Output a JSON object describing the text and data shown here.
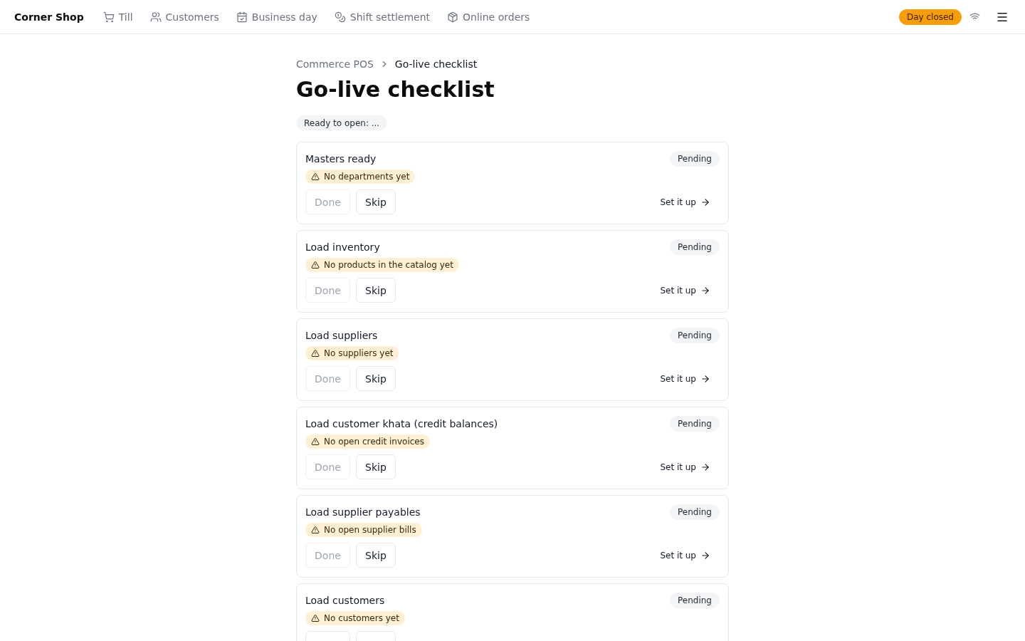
{
  "top_bar": {
    "brand": "Corner Shop",
    "nav": [
      {
        "label": "Till",
        "selected": false
      },
      {
        "label": "Customers",
        "selected": false
      },
      {
        "label": "Business day",
        "selected": false
      },
      {
        "label": "Shift settlement",
        "selected": false
      },
      {
        "label": "Online orders",
        "selected": false
      }
    ],
    "day_status": {
      "label": "Day closed",
      "open": false
    }
  },
  "breadcrumb": [
    {
      "label": "Commerce POS",
      "current": false
    },
    {
      "label": "Go-live checklist",
      "current": true
    }
  ],
  "title": "Go-live checklist",
  "readiness": "Ready to open: ...",
  "steps": [
    {
      "title": "Masters ready",
      "status": "Pending",
      "warning": "No departments yet",
      "actions": [
        {
          "kind": "done",
          "label": "Done",
          "disabled": true
        },
        {
          "kind": "skip",
          "label": "Skip",
          "disabled": false
        },
        {
          "kind": "setup",
          "label": "Set it up"
        }
      ]
    },
    {
      "title": "Load inventory",
      "status": "Pending",
      "warning": "No products in the catalog yet",
      "actions": [
        {
          "kind": "done",
          "label": "Done",
          "disabled": true
        },
        {
          "kind": "skip",
          "label": "Skip",
          "disabled": false
        },
        {
          "kind": "setup",
          "label": "Set it up"
        }
      ]
    },
    {
      "title": "Load suppliers",
      "status": "Pending",
      "warning": "No suppliers yet",
      "actions": [
        {
          "kind": "done",
          "label": "Done",
          "disabled": true
        },
        {
          "kind": "skip",
          "label": "Skip",
          "disabled": false
        },
        {
          "kind": "setup",
          "label": "Set it up"
        }
      ]
    },
    {
      "title": "Load customer khata (credit balances)",
      "status": "Pending",
      "warning": "No open credit invoices",
      "actions": [
        {
          "kind": "done",
          "label": "Done",
          "disabled": true
        },
        {
          "kind": "skip",
          "label": "Skip",
          "disabled": false
        },
        {
          "kind": "setup",
          "label": "Set it up"
        }
      ]
    },
    {
      "title": "Load supplier payables",
      "status": "Pending",
      "warning": "No open supplier bills",
      "actions": [
        {
          "kind": "done",
          "label": "Done",
          "disabled": true
        },
        {
          "kind": "skip",
          "label": "Skip",
          "disabled": false
        },
        {
          "kind": "setup",
          "label": "Set it up"
        }
      ]
    },
    {
      "title": "Load customers",
      "status": "Pending",
      "warning": "No customers yet",
      "actions": [
        {
          "kind": "done"
        },
        {
          "kind": "skip"
        }
      ]
    }
  ]
}
